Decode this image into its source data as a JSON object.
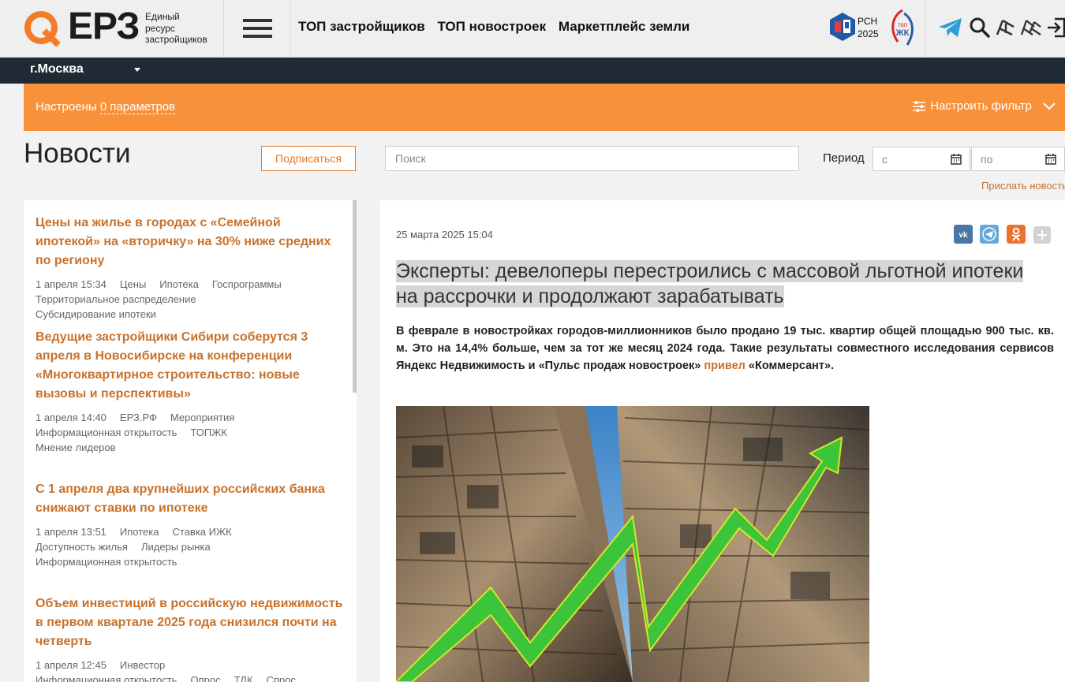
{
  "header": {
    "logo_text": "ЕРЗ",
    "logo_sub": [
      "Единый",
      "ресурс",
      "застройщиков"
    ],
    "nav": [
      "ТОП застройщиков",
      "ТОП новостроек",
      "Маркетплейс земли"
    ],
    "rsn": [
      "РСН",
      "2025"
    ],
    "topzhk": [
      "топ",
      "ЖК"
    ]
  },
  "city": "г.Москва",
  "filter": {
    "prefix": "Настроены",
    "count": "0 параметров",
    "action": "Настроить фильтр"
  },
  "page": {
    "title": "Новости",
    "subscribe": "Подписаться",
    "search_placeholder": "Поиск",
    "period_label": "Период",
    "from_placeholder": "с",
    "to_placeholder": "по",
    "send_news": "Прислать новость"
  },
  "news": [
    {
      "title": "Цены на жилье в городах с «Семейной ипотекой» на «вторичку» на 30% ниже средних по региону",
      "date": "1 апреля 15:34",
      "tags": [
        "Цены",
        "Ипотека",
        "Госпрограммы",
        "Территориальное распределение",
        "Субсидирование ипотеки"
      ]
    },
    {
      "title": "Ведущие застройщики Сибири соберутся 3 апреля в Новосибирске на конференции «Многоквартирное строительство: новые вызовы и перспективы»",
      "date": "1 апреля 14:40",
      "tags": [
        "ЕРЗ.РФ",
        "Мероприятия",
        "Информационная открытость",
        "ТОПЖК",
        "Мнение лидеров"
      ]
    },
    {
      "title": "С 1 апреля два крупнейших российских банка снижают ставки по ипотеке",
      "date": "1 апреля 13:51",
      "tags": [
        "Ипотека",
        "Ставка ИЖК",
        "Доступность жилья",
        "Лидеры рынка",
        "Информационная открытость"
      ]
    },
    {
      "title": "Объем инвестиций в российскую недвижимость в первом квартале 2025 года снизился почти на четверть",
      "date": "1 апреля 12:45",
      "tags": [
        "Инвестор",
        "Информационная открытость",
        "Опрос",
        "ТДК",
        "Спрос"
      ]
    }
  ],
  "article": {
    "date": "25 марта 2025 15:04",
    "title": "Эксперты: девелоперы перестроились с массовой льготной ипотеки на рассрочки и продолжают зарабатывать",
    "lead_before": "В феврале в новостройках городов-миллионников было продано 19 тыс. квартир общей площадью 900 тыс. кв. м. Это на 14,4% больше, чем за тот же месяц 2024 года. Такие результаты совместного исследования сервисов Яндекс Недвижимость и «Пульс продаж новостроек» ",
    "lead_link": "привел",
    "lead_after": " «Коммерсант».",
    "share": [
      "vk-icon",
      "telegram-icon",
      "odnoklassniki-icon",
      "plus-icon"
    ]
  },
  "colors": {
    "accent": "#f7913a",
    "link": "#c8722c",
    "dark_bar": "#1f2a35"
  }
}
